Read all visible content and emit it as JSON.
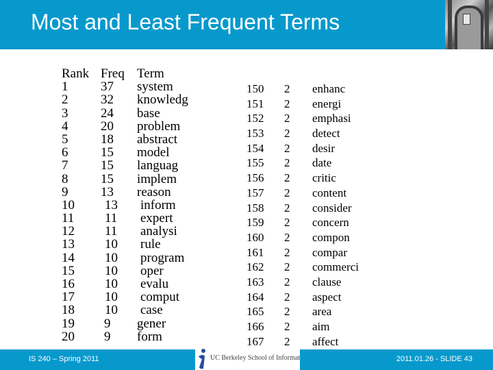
{
  "slide": {
    "title": "Most and Least Frequent Terms",
    "footer": {
      "course": "IS 240 – Spring 2011",
      "school": "UC Berkeley School of Information",
      "slide_label": "2011.01.26 - SLIDE 43"
    },
    "colors": {
      "accent": "#0899cc",
      "text": "#000000",
      "title_text": "#ffffff"
    },
    "icons": {
      "header_photo": "building-photo",
      "logo": "ischool-logo-icon"
    }
  },
  "most_frequent": {
    "headers": [
      "Rank",
      "Freq",
      "Term"
    ],
    "rows": [
      [
        "1",
        "37",
        "system"
      ],
      [
        "2",
        "32",
        "knowledg"
      ],
      [
        "3",
        "24",
        "base"
      ],
      [
        "4",
        "20",
        "problem"
      ],
      [
        "5",
        "18",
        "abstract"
      ],
      [
        "6",
        "15",
        "model"
      ],
      [
        "7",
        "15",
        "languag"
      ],
      [
        "8",
        "15",
        "implem"
      ],
      [
        "9",
        "13",
        "reason"
      ],
      [
        "10",
        "13",
        "inform"
      ],
      [
        "11",
        "11",
        "expert"
      ],
      [
        "12",
        "11",
        "analysi"
      ],
      [
        "13",
        "10",
        "rule"
      ],
      [
        "14",
        "10",
        "program"
      ],
      [
        "15",
        "10",
        "oper"
      ],
      [
        "16",
        "10",
        "evalu"
      ],
      [
        "17",
        "10",
        "comput"
      ],
      [
        "18",
        "10",
        "case"
      ],
      [
        "19",
        "9",
        "gener"
      ],
      [
        "20",
        "9",
        "form"
      ]
    ]
  },
  "least_frequent": {
    "rows": [
      [
        "150",
        "2",
        "enhanc"
      ],
      [
        "151",
        "2",
        "energi"
      ],
      [
        "152",
        "2",
        "emphasi"
      ],
      [
        "153",
        "2",
        "detect"
      ],
      [
        "154",
        "2",
        "desir"
      ],
      [
        "155",
        "2",
        "date"
      ],
      [
        "156",
        "2",
        "critic"
      ],
      [
        "157",
        "2",
        "content"
      ],
      [
        "158",
        "2",
        "consider"
      ],
      [
        "159",
        "2",
        "concern"
      ],
      [
        "160",
        "2",
        "compon"
      ],
      [
        "161",
        "2",
        "compar"
      ],
      [
        "162",
        "2",
        "commerci"
      ],
      [
        "163",
        "2",
        "clause"
      ],
      [
        "164",
        "2",
        "aspect"
      ],
      [
        "165",
        "2",
        "area"
      ],
      [
        "166",
        "2",
        "aim"
      ],
      [
        "167",
        "2",
        "affect"
      ]
    ]
  }
}
